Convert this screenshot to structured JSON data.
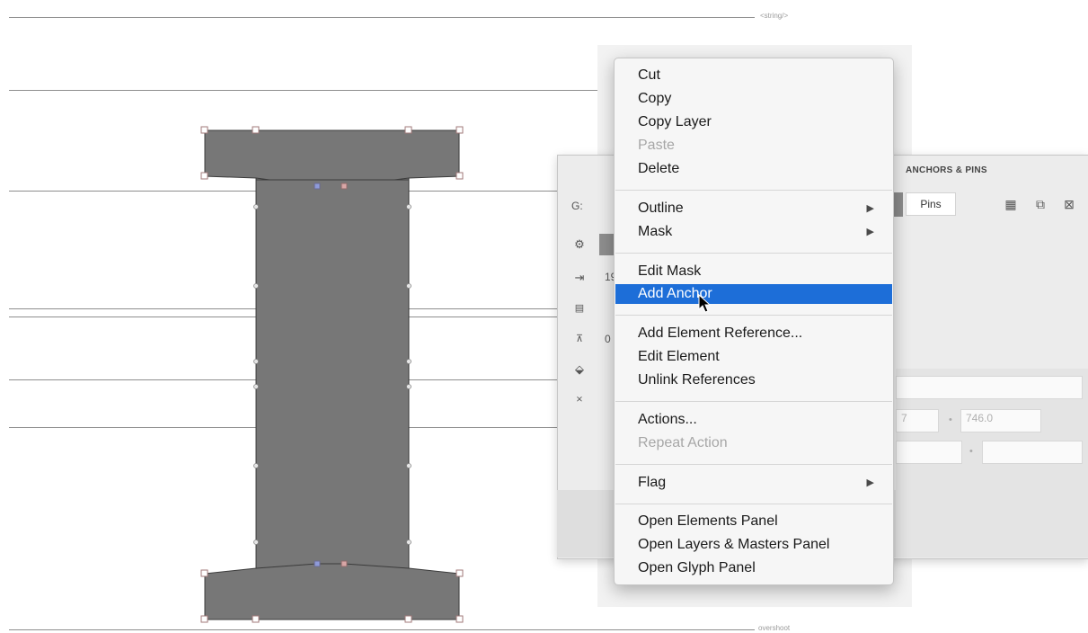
{
  "canvas": {
    "metric_labels": {
      "top": "<string/>",
      "bottom": "overshoot"
    }
  },
  "panel": {
    "title": "ANCHORS & PINS",
    "glyph_label": "G:",
    "width_value": "19",
    "zero_value": "0",
    "pins_label": "Pins",
    "coord_x": "7",
    "coord_y": "746.0",
    "icons": [
      "gear-icon",
      "width-arrow-icon",
      "calculator-icon",
      "baseline-icon",
      "fill-icon",
      "x-icon"
    ]
  },
  "menu": {
    "cut": "Cut",
    "copy": "Copy",
    "copy_layer": "Copy Layer",
    "paste": "Paste",
    "delete": "Delete",
    "outline": "Outline",
    "mask": "Mask",
    "edit_mask": "Edit Mask",
    "add_anchor": "Add Anchor",
    "add_element_reference": "Add Element Reference...",
    "edit_element": "Edit Element",
    "unlink_references": "Unlink References",
    "actions": "Actions...",
    "repeat_action": "Repeat Action",
    "flag": "Flag",
    "open_elements_panel": "Open Elements Panel",
    "open_layers_masters_panel": "Open Layers & Masters Panel",
    "open_glyph_panel": "Open Glyph Panel",
    "submenu_arrow": "▶"
  },
  "colors": {
    "glyph_fill": "#777777",
    "highlight": "#1d6ed8"
  }
}
